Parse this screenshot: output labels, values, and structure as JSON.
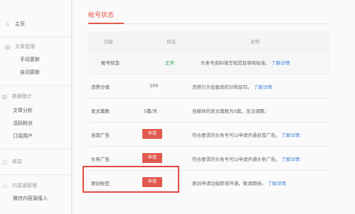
{
  "sidebar": {
    "home": "主页",
    "article_manage": "文章管理",
    "manual_update": "手动更新",
    "auto_update": "自动更新",
    "data_stats": "数据统计",
    "article_analysis": "文章分析",
    "active_fans": "活跃粉丝",
    "subscribers": "订阅用户",
    "revenue": "收益",
    "content_source": "内容源管理",
    "wechat_source": "微信内容源接入"
  },
  "panel": {
    "title": "帐号状态",
    "col_feature": "功能",
    "col_status": "状态",
    "col_desc": "说明"
  },
  "rows": [
    {
      "name": "帐号状态",
      "status": "正常",
      "desc": "头条号资料填写规范及审核标准。",
      "link": "了解详情"
    },
    {
      "name": "违禁分值",
      "status": "100",
      "desc": "违禁行为会触发扣分和惩罚。",
      "link": "了解详情"
    },
    {
      "name": "发文篇数",
      "status": "5篇/天",
      "desc": "自媒体的发文篇数为5篇，无法调整。",
      "link": ""
    },
    {
      "name": "自营广告",
      "button": "申请",
      "desc": "符合要求的头条号可以申请开通自营广告。",
      "link": "了解详情"
    },
    {
      "name": "头条广告",
      "button": "申请",
      "desc": "符合要求的头条号可以申请开通头条广告。",
      "link": "了解详情"
    },
    {
      "name": "原创标签",
      "button": "申请",
      "desc": "原创申请功能即将开通，敬请期待。",
      "link": "了解详情"
    }
  ],
  "colors": {
    "accent": "#e2574c",
    "link": "#4a86d8",
    "ok": "#2ea44f"
  }
}
